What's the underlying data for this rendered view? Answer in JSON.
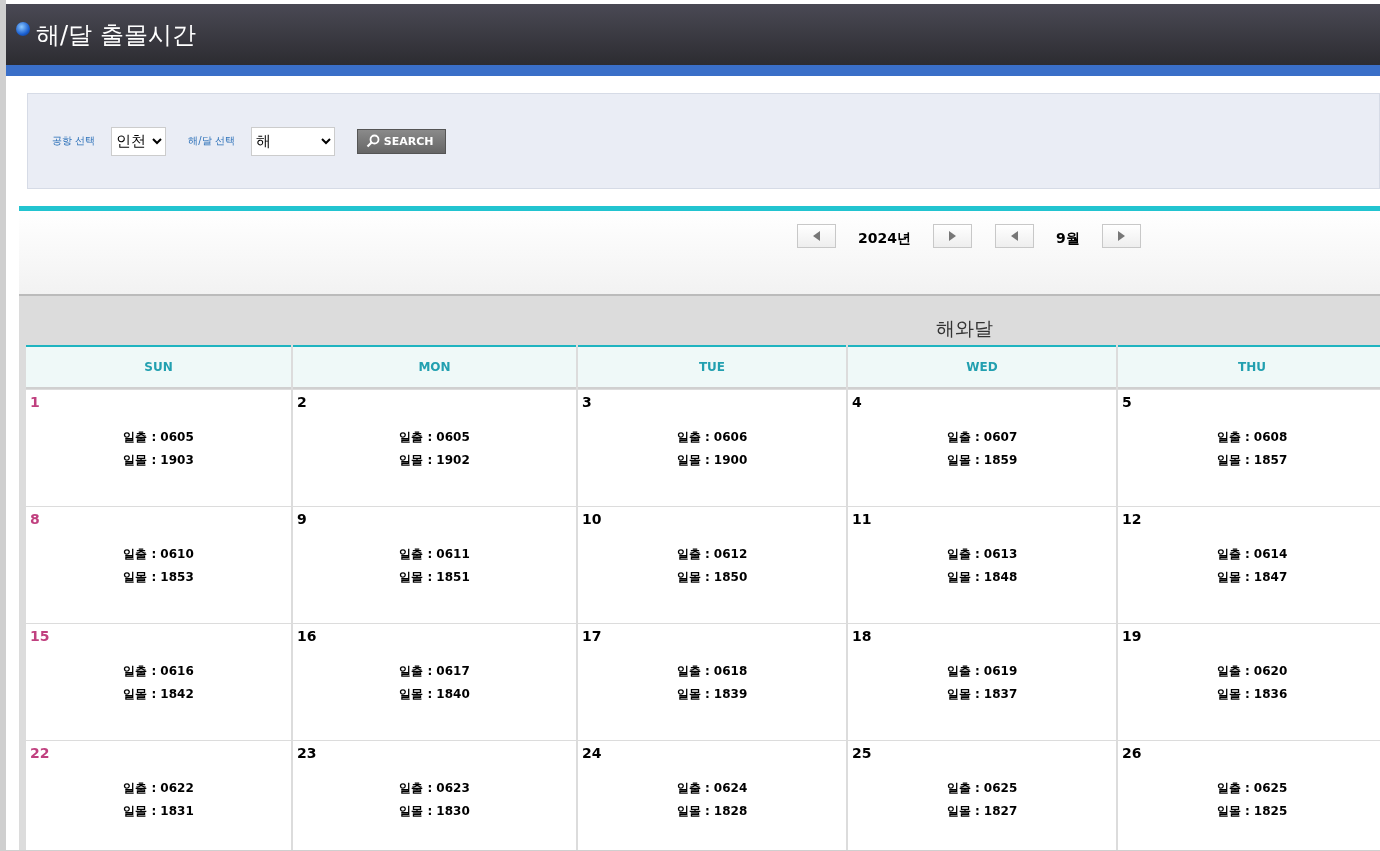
{
  "page_title": "해/달 출몰시간",
  "filters": [
    {
      "label": "공항 선택",
      "value": "인천"
    },
    {
      "label": "해/달 선택",
      "value": "해"
    }
  ],
  "search_button": "SEARCH",
  "nav": {
    "year": "2024년",
    "month": "9월"
  },
  "calendar": {
    "title": "해와달",
    "weekdays": [
      "SUN",
      "MON",
      "TUE",
      "WED",
      "THU"
    ],
    "weeks": [
      [
        {
          "day": "1",
          "sunrise": "일출 : 0605",
          "sunset": "일몰 : 1903"
        },
        {
          "day": "2",
          "sunrise": "일출 : 0605",
          "sunset": "일몰 : 1902"
        },
        {
          "day": "3",
          "sunrise": "일출 : 0606",
          "sunset": "일몰 : 1900"
        },
        {
          "day": "4",
          "sunrise": "일출 : 0607",
          "sunset": "일몰 : 1859"
        },
        {
          "day": "5",
          "sunrise": "일출 : 0608",
          "sunset": "일몰 : 1857"
        }
      ],
      [
        {
          "day": "8",
          "sunrise": "일출 : 0610",
          "sunset": "일몰 : 1853"
        },
        {
          "day": "9",
          "sunrise": "일출 : 0611",
          "sunset": "일몰 : 1851"
        },
        {
          "day": "10",
          "sunrise": "일출 : 0612",
          "sunset": "일몰 : 1850"
        },
        {
          "day": "11",
          "sunrise": "일출 : 0613",
          "sunset": "일몰 : 1848"
        },
        {
          "day": "12",
          "sunrise": "일출 : 0614",
          "sunset": "일몰 : 1847"
        }
      ],
      [
        {
          "day": "15",
          "sunrise": "일출 : 0616",
          "sunset": "일몰 : 1842"
        },
        {
          "day": "16",
          "sunrise": "일출 : 0617",
          "sunset": "일몰 : 1840"
        },
        {
          "day": "17",
          "sunrise": "일출 : 0618",
          "sunset": "일몰 : 1839"
        },
        {
          "day": "18",
          "sunrise": "일출 : 0619",
          "sunset": "일몰 : 1837"
        },
        {
          "day": "19",
          "sunrise": "일출 : 0620",
          "sunset": "일몰 : 1836"
        }
      ],
      [
        {
          "day": "22",
          "sunrise": "일출 : 0622",
          "sunset": "일몰 : 1831"
        },
        {
          "day": "23",
          "sunrise": "일출 : 0623",
          "sunset": "일몰 : 1830"
        },
        {
          "day": "24",
          "sunrise": "일출 : 0624",
          "sunset": "일몰 : 1828"
        },
        {
          "day": "25",
          "sunrise": "일출 : 0625",
          "sunset": "일몰 : 1827"
        },
        {
          "day": "26",
          "sunrise": "일출 : 0625",
          "sunset": "일몰 : 1825"
        }
      ]
    ]
  }
}
